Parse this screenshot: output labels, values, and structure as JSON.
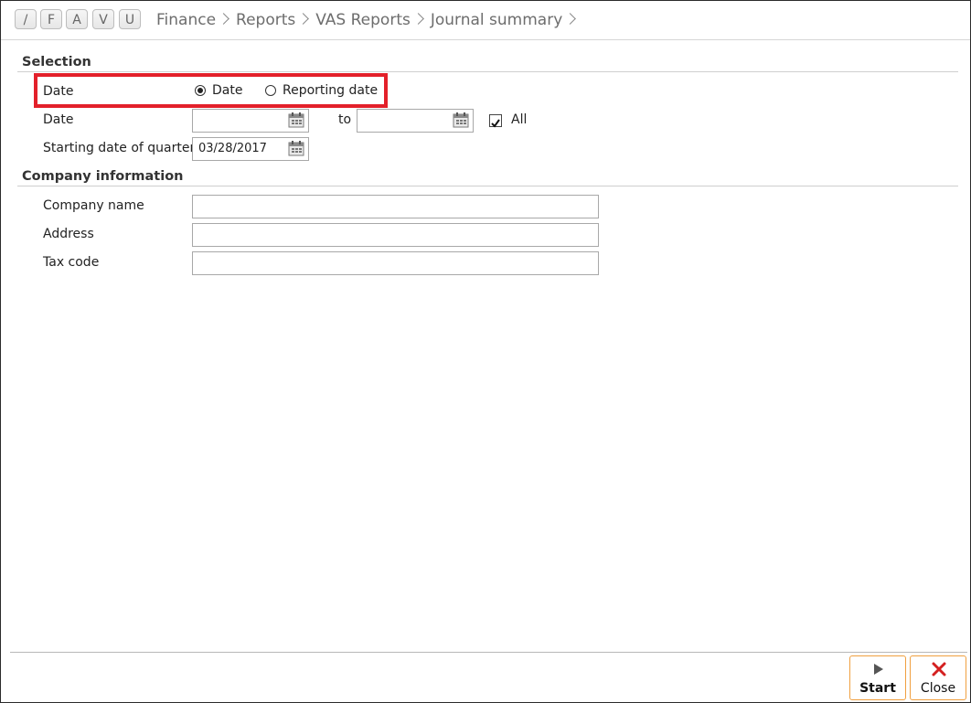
{
  "toolbar": {
    "buttons": [
      "/",
      "F",
      "A",
      "V",
      "U"
    ]
  },
  "breadcrumb": [
    "Finance",
    "Reports",
    "VAS Reports",
    "Journal summary"
  ],
  "selection": {
    "title": "Selection",
    "date_type_label": "Date",
    "radio_date": "Date",
    "radio_reporting_date": "Reporting date",
    "selected_option": "Date",
    "date_label": "Date",
    "date_from": "",
    "to_label": "to",
    "date_to": "",
    "all_label": "All",
    "all_checked": true,
    "quarter_label": "Starting date of quarter",
    "quarter_value": "03/28/2017"
  },
  "company": {
    "title": "Company information",
    "name_label": "Company name",
    "name_value": "",
    "address_label": "Address",
    "address_value": "",
    "tax_label": "Tax code",
    "tax_value": ""
  },
  "actions": {
    "start_label": "Start",
    "close_label": "Close"
  },
  "colors": {
    "highlight": "#e3202a",
    "button_border": "#f0a040",
    "close_icon": "#d42020"
  }
}
